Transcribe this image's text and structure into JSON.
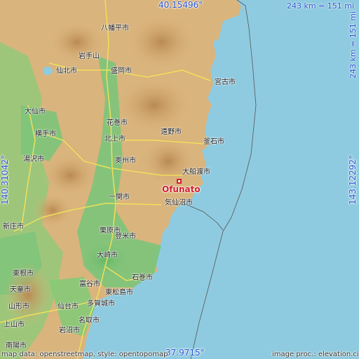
{
  "coordinates": {
    "top": "40.15496°",
    "bottom": "37.9715°",
    "left": "140.31042°",
    "right": "143.12292°"
  },
  "scale": {
    "horizontal": "243 km = 151 mi",
    "vertical": "243 km = 151 mi"
  },
  "target": {
    "name": "Ofunato"
  },
  "places": {
    "p01": "八幡平市",
    "p02": "岩手山",
    "p03": "仙北市",
    "p04": "盛岡市",
    "p05": "宮古市",
    "p06": "大仙市",
    "p07": "花巻市",
    "p08": "遠野市",
    "p09": "釜石市",
    "p10": "横手市",
    "p11": "北上市",
    "p12": "湯沢市",
    "p13": "奥州市",
    "p14": "大船渡市",
    "p15": "一関市",
    "p16": "気仙沼市",
    "p17": "新庄市",
    "p18": "栗原市",
    "p19": "登米市",
    "p20": "大崎市",
    "p21": "石巻市",
    "p22": "東根市",
    "p23": "富谷市",
    "p24": "東松島市",
    "p25": "天童市",
    "p26": "多賀城市",
    "p27": "山形市",
    "p28": "仙台市",
    "p29": "名取市",
    "p30": "上山市",
    "p31": "岩沼市",
    "p32": "南陽市"
  },
  "attribution": {
    "left": "map data: openstreetmap, style: opentopomap",
    "right": "image proc.: elevation.city"
  },
  "colors": {
    "sea": "#8fcbe0",
    "lowland": "#7cc47a",
    "highland": "#d9b47c",
    "road": "#f3e25a",
    "marker": "#d2202c",
    "coord_text": "#2a55d0"
  }
}
